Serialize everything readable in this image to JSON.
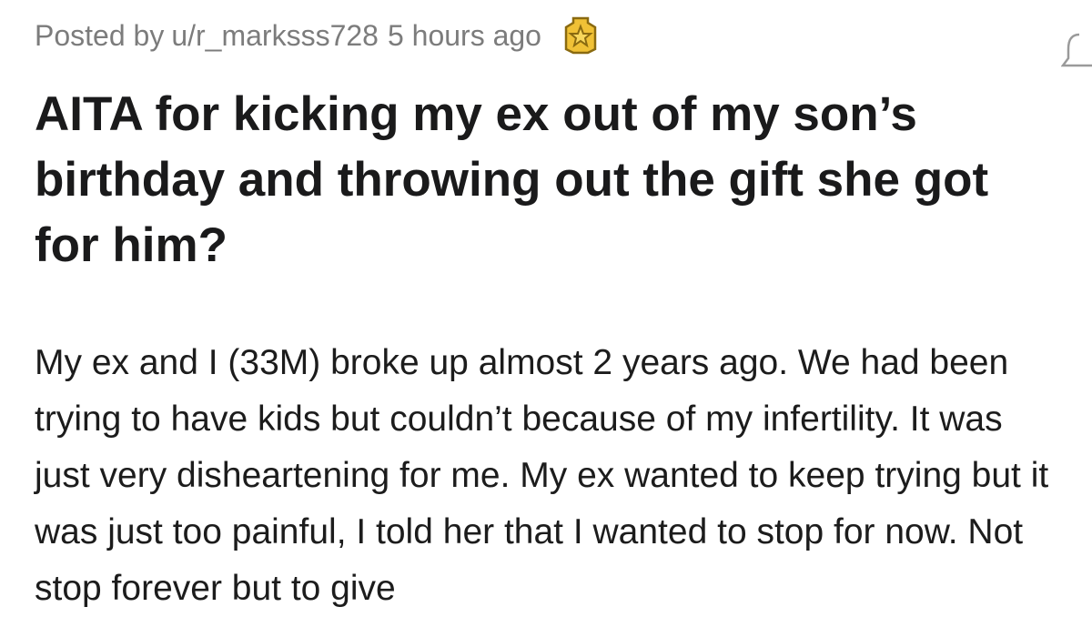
{
  "post": {
    "meta": {
      "posted_by_prefix": "Posted by",
      "username": "u/r_marksss728",
      "time_ago": "5 hours ago",
      "award_icon": "star-award-icon",
      "bell_icon": "notification-bell-icon"
    },
    "title": "AITA for kicking my ex out of my son’s birthday and throwing out the gift she got for him?",
    "body": "My ex and I (33M) broke up almost 2 years ago. We had been trying to have kids but couldn’t because of my infertility. It was just very disheartening for me. My ex wanted to keep trying but it was just too painful, I told her that I wanted to stop for now. Not stop forever but to give"
  },
  "colors": {
    "meta_text": "#7c7c7c",
    "title_text": "#1a1a1b",
    "body_text": "#1c1c1c",
    "award_gold": "#f0c136",
    "award_dark": "#8a6a10"
  }
}
